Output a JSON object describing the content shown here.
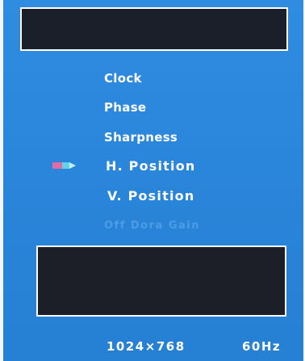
{
  "menu": {
    "items": [
      {
        "label": "Clock"
      },
      {
        "label": "Phase"
      },
      {
        "label": "Sharpness"
      },
      {
        "label": "H. Position"
      },
      {
        "label": "V. Position"
      },
      {
        "label": "Off Dora Gain"
      }
    ],
    "selected_index": 3
  },
  "status": {
    "resolution": "1024×768",
    "refresh_rate": "60Hz"
  },
  "colors": {
    "background": "#2a86da",
    "text": "#ffffff",
    "disabled_text": "#4d9ce6",
    "box_fill": "#1a1f2a",
    "selector_pink": "#e46aa6",
    "selector_cyan": "#5fd3e8"
  },
  "icons": {
    "selector": "pencil-cursor-icon"
  }
}
